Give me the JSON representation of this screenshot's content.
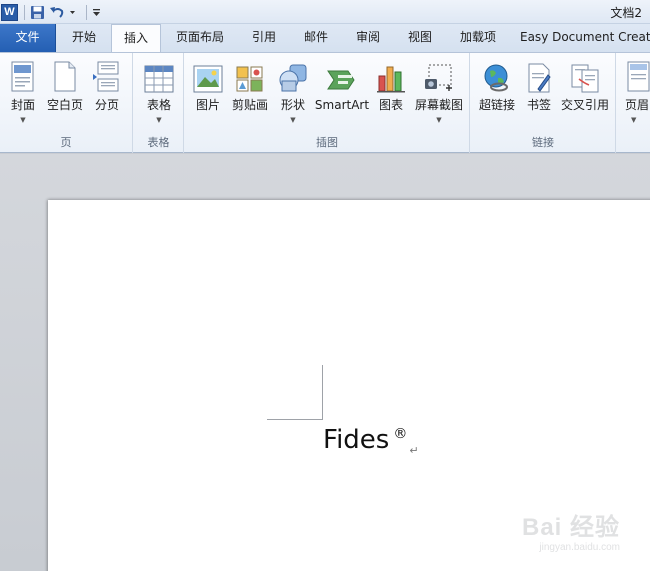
{
  "window": {
    "doc_title": "文档2",
    "app_icon_letter": "W"
  },
  "tabs": [
    {
      "label": "文件"
    },
    {
      "label": "开始"
    },
    {
      "label": "插入"
    },
    {
      "label": "页面布局"
    },
    {
      "label": "引用"
    },
    {
      "label": "邮件"
    },
    {
      "label": "审阅"
    },
    {
      "label": "视图"
    },
    {
      "label": "加载项"
    },
    {
      "label": "Easy Document Creator"
    }
  ],
  "ribbon": {
    "groups": [
      {
        "label": "页",
        "buttons": [
          {
            "label": "封面"
          },
          {
            "label": "空白页"
          },
          {
            "label": "分页"
          }
        ]
      },
      {
        "label": "表格",
        "buttons": [
          {
            "label": "表格"
          }
        ]
      },
      {
        "label": "插图",
        "buttons": [
          {
            "label": "图片"
          },
          {
            "label": "剪贴画"
          },
          {
            "label": "形状"
          },
          {
            "label": "SmartArt"
          },
          {
            "label": "图表"
          },
          {
            "label": "屏幕截图"
          }
        ]
      },
      {
        "label": "链接",
        "buttons": [
          {
            "label": "超链接"
          },
          {
            "label": "书签"
          },
          {
            "label": "交叉引用"
          }
        ]
      },
      {
        "label": "",
        "buttons": [
          {
            "label": "页眉"
          }
        ]
      }
    ]
  },
  "document": {
    "text": "Fides",
    "symbol": "®",
    "paragraph_mark": "↵"
  },
  "watermark": {
    "logo": "Bai 经验",
    "url": "jingyan.baidu.com"
  },
  "colors": {
    "file_tab": "#2b64b6",
    "ribbon_bg": "#f4f7fb",
    "workspace": "#cfd2d7"
  }
}
